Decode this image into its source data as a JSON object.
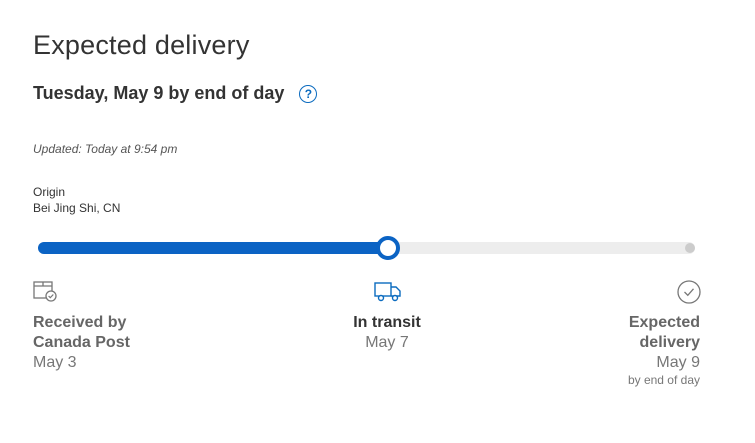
{
  "heading": "Expected delivery",
  "expected_date": "Tuesday, May 9 by end of day",
  "help_icon": "help-circle-icon",
  "updated": "Updated: Today at 9:54 pm",
  "origin": {
    "label": "Origin",
    "value": "Bei Jing Shi, CN"
  },
  "progress": {
    "fraction": 0.533,
    "fill_color": "#0b63c4",
    "track_color": "#ededed"
  },
  "steps": [
    {
      "icon": "package-check-icon",
      "title_line1": "Received by",
      "title_line2": "Canada Post",
      "date": "May 3"
    },
    {
      "icon": "truck-icon",
      "title": "In transit",
      "date": "May 7"
    },
    {
      "icon": "check-circle-icon",
      "title_line1": "Expected",
      "title_line2": "delivery",
      "date": "May 9",
      "note": "by end of day"
    }
  ]
}
